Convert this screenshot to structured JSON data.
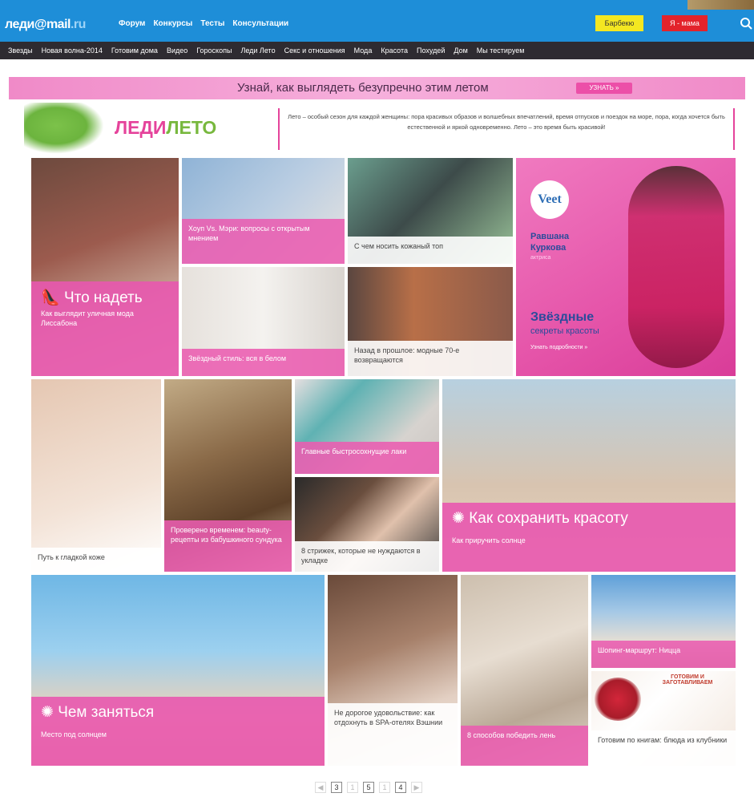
{
  "header": {
    "logo_main": "леди",
    "logo_at": "@mail",
    "logo_ru": ".ru",
    "nav": [
      "Форум",
      "Конкурсы",
      "Тесты",
      "Консультации"
    ],
    "yellow_btn": "Барбекю",
    "red_btn": "Я - мама"
  },
  "subnav": [
    "Звезды",
    "Новая волна-2014",
    "Готовим дома",
    "Видео",
    "Гороскопы",
    "Леди Лето",
    "Секс и отношения",
    "Мода",
    "Красота",
    "Похудей",
    "Дом",
    "Мы тестируем"
  ],
  "banner": {
    "text": "Узнай, как выглядеть безупречно этим летом",
    "button": "УЗНАТЬ »"
  },
  "brand": {
    "title_a": "ЛЕДИ",
    "title_b": "ЛЕТО",
    "desc": "Лето – особый сезон для каждой женщины: пора красивых образов и волшебных впечатлений, время отпусков и поездок на море, пора, когда хочется быть естественной и яркой одновременно. Лето – это время быть красивой!"
  },
  "tiles": {
    "what_to_wear_title": "Что надеть",
    "what_to_wear_sub": "Как выглядит уличная мода Лиссабона",
    "t1": "Хоуп Vs. Мэри: вопросы с открытым мнением",
    "t2": "С чем носить кожаный топ",
    "t3": "Звёздный стиль: вся в белом",
    "t4": "Назад в прошлое: модные 70-е возвращаются",
    "ad_brand": "Veet",
    "ad_name1": "Равшана",
    "ad_name2": "Куркова",
    "ad_sub": "актриса",
    "ad_title1": "Звёздные",
    "ad_title2": "секреты красоты",
    "ad_more": "Узнать подробности »",
    "legs": "Путь к гладкой коже",
    "recipes": "Проверено временем: beauty-рецепты из бабушкиного сундука",
    "nails": "Главные быстросохнущие лаки",
    "hair": "8 стрижек, которые не нуждаются в укладке",
    "beauty_title": "Как сохранить красоту",
    "beauty_sub": "Как приручить солнце",
    "what_to_do_title": "Чем заняться",
    "what_to_do_sub": "Место под солнцем",
    "spa": "Не дорогое удовольствие: как отдохнуть в SPA-отелях Вэшнии",
    "office": "8 способов победить лень",
    "nice": "Шопинг-маршрут: Ницца",
    "berries": "Готовим по книгам: блюда из клубники",
    "berries_book": "ГОТОВИМ И ЗАГОТАВЛИВАЕМ"
  },
  "pager": [
    "◀",
    "3",
    "1",
    "5",
    "1",
    "4",
    "▶"
  ]
}
